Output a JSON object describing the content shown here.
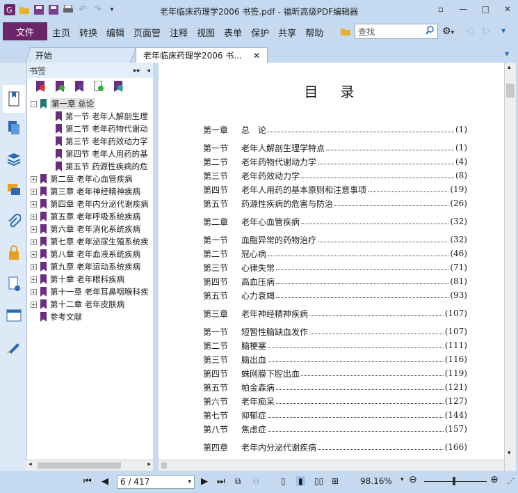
{
  "window": {
    "title": "老年临床药理学2006 书签.pdf - 福昕高级PDF编辑器"
  },
  "menu": {
    "file": "文件",
    "items": [
      "主页",
      "转换",
      "编辑",
      "页面管",
      "注释",
      "视图",
      "表单",
      "保护",
      "共享",
      "帮助"
    ],
    "search_placeholder": "查找"
  },
  "tabs": {
    "start": "开始",
    "doc": "老年临床药理学2006 书..."
  },
  "bookmarks": {
    "header": "书签",
    "items": [
      {
        "label": "第一章 总论",
        "level": 0,
        "exp": "-",
        "selected": true
      },
      {
        "label": "第一节 老年人解剖生理",
        "level": 1
      },
      {
        "label": "第二节 老年药物代谢动",
        "level": 1
      },
      {
        "label": "第三节 老年药效动力学",
        "level": 1
      },
      {
        "label": "第四节 老年人用药的基",
        "level": 1
      },
      {
        "label": "第五节 药源性疾病的危",
        "level": 1
      },
      {
        "label": "第二章 老年心血管疾病",
        "level": 0,
        "exp": "+"
      },
      {
        "label": "第三章 老年神经精神疾病",
        "level": 0,
        "exp": "+"
      },
      {
        "label": "第四章 老年内分泌代谢疾病",
        "level": 0,
        "exp": "+"
      },
      {
        "label": "第五章 老年呼吸系统疾病",
        "level": 0,
        "exp": "+"
      },
      {
        "label": "第六章 老年消化系统疾病",
        "level": 0,
        "exp": "+"
      },
      {
        "label": "第七章 老年泌尿生殖系统疾",
        "level": 0,
        "exp": "+"
      },
      {
        "label": "第八章 老年血液系统疾病",
        "level": 0,
        "exp": "+"
      },
      {
        "label": "第九章 老年运动系统疾病",
        "level": 0,
        "exp": "+"
      },
      {
        "label": "第十章 老年眼科疾病",
        "level": 0,
        "exp": "+"
      },
      {
        "label": "第十一章 老年耳鼻咽喉科疾",
        "level": 0,
        "exp": "+"
      },
      {
        "label": "第十二章 老年皮肤病",
        "level": 0,
        "exp": "+"
      },
      {
        "label": "参考文献",
        "level": 0
      }
    ]
  },
  "document": {
    "heading": "目　录",
    "toc": [
      {
        "n": "第一章",
        "t": "总　论",
        "p": "(1)",
        "gap": true
      },
      {
        "n": "第一节",
        "t": "老年人解剖生理学特点",
        "p": "(1)"
      },
      {
        "n": "第二节",
        "t": "老年药物代谢动力学",
        "p": "(4)"
      },
      {
        "n": "第三节",
        "t": "老年药效动力学",
        "p": "(8)"
      },
      {
        "n": "第四节",
        "t": "老年人用药的基本原则和注意事项",
        "p": "(19)"
      },
      {
        "n": "第五节",
        "t": "药源性疾病的危害与防治",
        "p": "(26)"
      },
      {
        "n": "第二章",
        "t": "老年心血管疾病",
        "p": "(32)",
        "gap": true
      },
      {
        "n": "第一节",
        "t": "血脂异常的药物治疗",
        "p": "(32)"
      },
      {
        "n": "第二节",
        "t": "冠心病",
        "p": "(46)"
      },
      {
        "n": "第三节",
        "t": "心律失常",
        "p": "(71)"
      },
      {
        "n": "第四节",
        "t": "高血压病",
        "p": "(81)"
      },
      {
        "n": "第五节",
        "t": "心力衰竭",
        "p": "(93)"
      },
      {
        "n": "第三章",
        "t": "老年神经精神疾病",
        "p": "(107)",
        "gap": true
      },
      {
        "n": "第一节",
        "t": "短暂性脑缺血发作",
        "p": "(107)"
      },
      {
        "n": "第二节",
        "t": "脑梗塞",
        "p": "(111)"
      },
      {
        "n": "第三节",
        "t": "脑出血",
        "p": "(116)"
      },
      {
        "n": "第四节",
        "t": "蛛网膜下腔出血",
        "p": "(119)"
      },
      {
        "n": "第五节",
        "t": "帕金森病",
        "p": "(121)"
      },
      {
        "n": "第六节",
        "t": "老年痴呆",
        "p": "(127)"
      },
      {
        "n": "第七节",
        "t": "抑郁症",
        "p": "(144)"
      },
      {
        "n": "第八节",
        "t": "焦虑症",
        "p": "(157)"
      },
      {
        "n": "第四章",
        "t": "老年内分泌代谢疾病",
        "p": "(166)",
        "gap": true
      }
    ]
  },
  "status": {
    "page": "6 / 417",
    "zoom": "98.16%"
  }
}
